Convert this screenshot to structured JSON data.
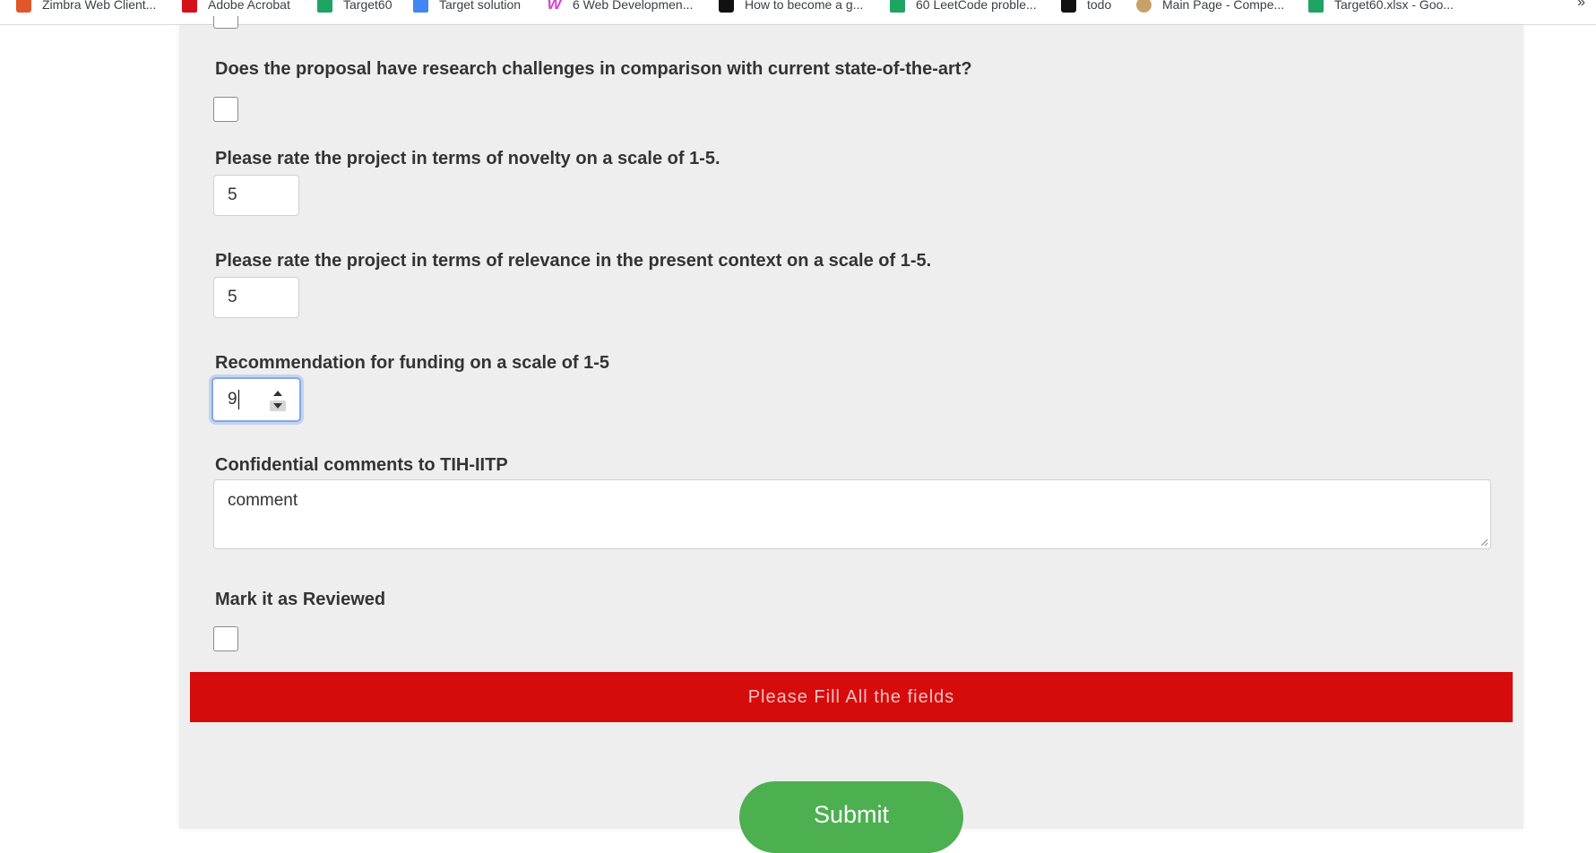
{
  "bookmarks": [
    {
      "label": "Zimbra Web Client...",
      "icon": "zimbra-icon"
    },
    {
      "label": "Adobe Acrobat",
      "icon": "acrobat-icon"
    },
    {
      "label": "Target60",
      "icon": "sheets-icon"
    },
    {
      "label": "Target solution",
      "icon": "docs-icon"
    },
    {
      "label": "6 Web Developmen...",
      "icon": "w-icon"
    },
    {
      "label": "How to become a g...",
      "icon": "medium-icon"
    },
    {
      "label": "60 LeetCode proble...",
      "icon": "sheets-icon"
    },
    {
      "label": "todo",
      "icon": "medium-icon"
    },
    {
      "label": "Main Page - Compe...",
      "icon": "wiki-icon"
    },
    {
      "label": "Target60.xlsx - Goo...",
      "icon": "sheets-icon"
    }
  ],
  "bookmarks_more": "»",
  "form": {
    "q_research_challenges": "Does the proposal have research challenges in comparison with current state-of-the-art?",
    "q_novelty": "Please rate the project in terms of novelty on a scale of 1-5.",
    "novelty_value": "5",
    "q_relevance": "Please rate the project in terms of relevance in the present context on a scale of 1-5.",
    "relevance_value": "5",
    "q_recommendation": "Recommendation for funding on a scale of 1-5",
    "recommendation_value": "9",
    "q_comments": "Confidential comments to TIH-IITP",
    "comments_value": "comment",
    "q_reviewed": "Mark it as Reviewed",
    "alert_text": "Please Fill All the fields",
    "submit_label": "Submit"
  },
  "colors": {
    "alert_bg": "#d60b0b",
    "submit_bg": "#4caf50",
    "panel_bg": "#eeeeee"
  }
}
